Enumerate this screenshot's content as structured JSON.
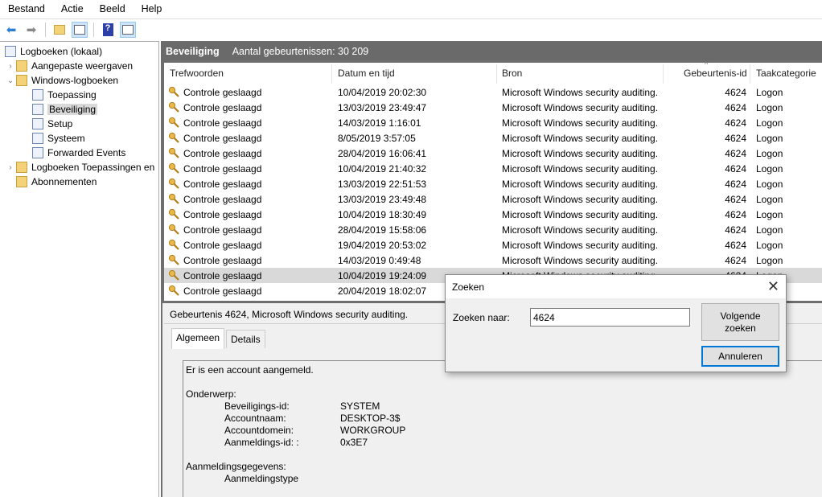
{
  "menu": [
    "Bestand",
    "Actie",
    "Beeld",
    "Help"
  ],
  "toolbar": {
    "icons": [
      "back-arrow-icon",
      "forward-arrow-icon",
      "folder-up-icon",
      "show-hide-console-tree-icon",
      "help-icon",
      "show-hide-action-pane-icon"
    ]
  },
  "tree": {
    "root": "Logboeken (lokaal)",
    "items": [
      {
        "label": "Aangepaste weergaven",
        "level": 1,
        "expander": ">"
      },
      {
        "label": "Windows-logboeken",
        "level": 1,
        "expander": "v"
      },
      {
        "label": "Toepassing",
        "level": 2
      },
      {
        "label": "Beveiliging",
        "level": 2,
        "selected": true
      },
      {
        "label": "Setup",
        "level": 2
      },
      {
        "label": "Systeem",
        "level": 2
      },
      {
        "label": "Forwarded Events",
        "level": 2
      },
      {
        "label": "Logboeken Toepassingen en",
        "level": 1,
        "expander": ">"
      },
      {
        "label": "Abonnementen",
        "level": 1
      }
    ]
  },
  "header": {
    "title": "Beveiliging",
    "count": "Aantal gebeurtenissen: 30 209"
  },
  "columns": [
    "Trefwoorden",
    "Datum en tijd",
    "Bron",
    "Gebeurtenis-id",
    "Taakcategorie"
  ],
  "rows": [
    [
      "Controle geslaagd",
      "10/04/2019 20:02:30",
      "Microsoft Windows security auditing.",
      "4624",
      "Logon"
    ],
    [
      "Controle geslaagd",
      "13/03/2019 23:49:47",
      "Microsoft Windows security auditing.",
      "4624",
      "Logon"
    ],
    [
      "Controle geslaagd",
      "14/03/2019 1:16:01",
      "Microsoft Windows security auditing.",
      "4624",
      "Logon"
    ],
    [
      "Controle geslaagd",
      "8/05/2019 3:57:05",
      "Microsoft Windows security auditing.",
      "4624",
      "Logon"
    ],
    [
      "Controle geslaagd",
      "28/04/2019 16:06:41",
      "Microsoft Windows security auditing.",
      "4624",
      "Logon"
    ],
    [
      "Controle geslaagd",
      "10/04/2019 21:40:32",
      "Microsoft Windows security auditing.",
      "4624",
      "Logon"
    ],
    [
      "Controle geslaagd",
      "13/03/2019 22:51:53",
      "Microsoft Windows security auditing.",
      "4624",
      "Logon"
    ],
    [
      "Controle geslaagd",
      "13/03/2019 23:49:48",
      "Microsoft Windows security auditing.",
      "4624",
      "Logon"
    ],
    [
      "Controle geslaagd",
      "10/04/2019 18:30:49",
      "Microsoft Windows security auditing.",
      "4624",
      "Logon"
    ],
    [
      "Controle geslaagd",
      "28/04/2019 15:58:06",
      "Microsoft Windows security auditing.",
      "4624",
      "Logon"
    ],
    [
      "Controle geslaagd",
      "19/04/2019 20:53:02",
      "Microsoft Windows security auditing.",
      "4624",
      "Logon"
    ],
    [
      "Controle geslaagd",
      "14/03/2019 0:49:48",
      "Microsoft Windows security auditing.",
      "4624",
      "Logon"
    ],
    [
      "Controle geslaagd",
      "10/04/2019 19:24:09",
      "Microsoft Windows security auditing.",
      "4624",
      "Logon"
    ],
    [
      "Controle geslaagd",
      "20/04/2019 18:02:07",
      "",
      "",
      ""
    ]
  ],
  "highlighted_row": 12,
  "detail": {
    "title": "Gebeurtenis 4624, Microsoft Windows security auditing.",
    "tabs": [
      "Algemeen",
      "Details"
    ],
    "active_tab": "Algemeen",
    "intro": "Er is een account aangemeld.",
    "section1": "Onderwerp:",
    "fields": [
      [
        "Beveiligings-id:",
        "SYSTEM"
      ],
      [
        "Accountnaam:",
        "DESKTOP-3$"
      ],
      [
        "Accountdomein:",
        "WORKGROUP"
      ],
      [
        "Aanmeldings-id: :",
        "0x3E7"
      ]
    ],
    "section2": "Aanmeldingsgegevens:",
    "field2": "Aanmeldingstype"
  },
  "dialog": {
    "title": "Zoeken",
    "label": "Zoeken naar:",
    "value": "4624",
    "find_next": "Volgende zoeken",
    "cancel": "Annuleren"
  }
}
